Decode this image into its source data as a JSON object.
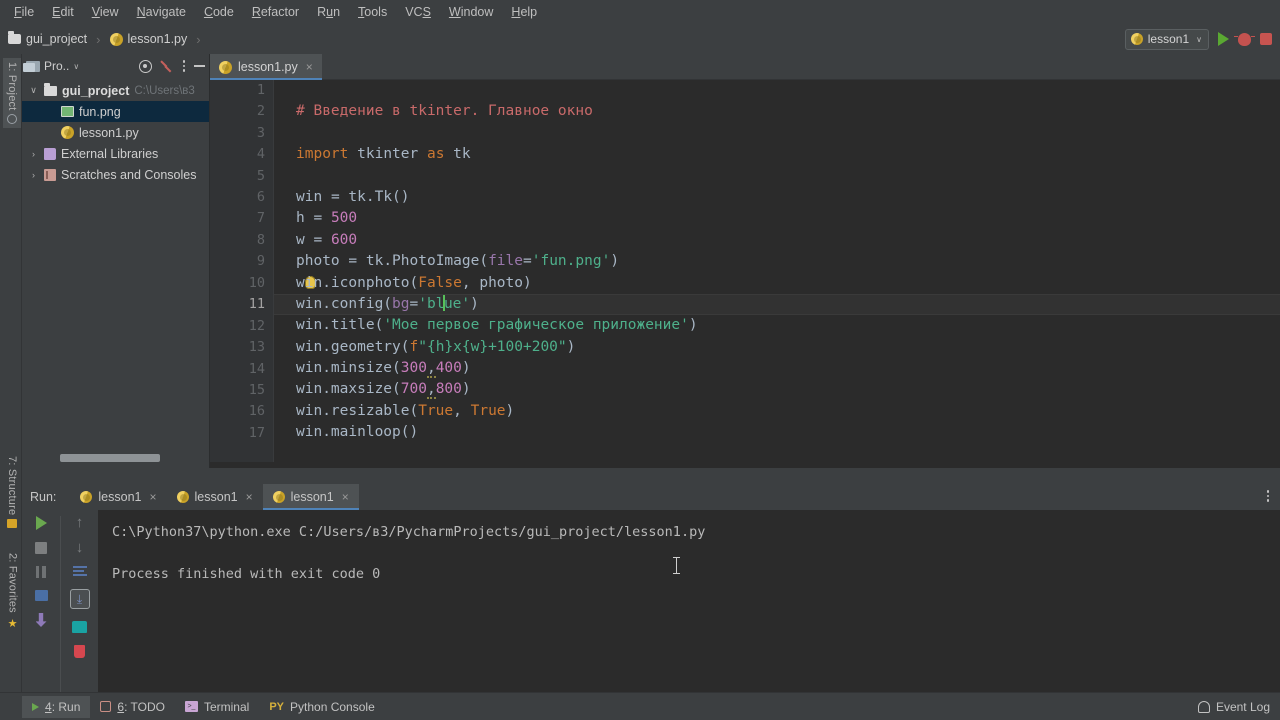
{
  "menubar": {
    "items": [
      {
        "label": "File",
        "mnemonic": "F"
      },
      {
        "label": "Edit",
        "mnemonic": "E"
      },
      {
        "label": "View",
        "mnemonic": "V"
      },
      {
        "label": "Navigate",
        "mnemonic": "N"
      },
      {
        "label": "Code",
        "mnemonic": "C"
      },
      {
        "label": "Refactor",
        "mnemonic": "R"
      },
      {
        "label": "Run",
        "mnemonic": "u"
      },
      {
        "label": "Tools",
        "mnemonic": "T"
      },
      {
        "label": "VCS",
        "mnemonic": "S"
      },
      {
        "label": "Window",
        "mnemonic": "W"
      },
      {
        "label": "Help",
        "mnemonic": "H"
      }
    ]
  },
  "breadcrumb": {
    "project": "gui_project",
    "file": "lesson1.py",
    "separator": "›"
  },
  "toolbar": {
    "run_config": "lesson1",
    "chevron": "∨",
    "run_icon": "run-triangle-icon",
    "debug_icon": "debug-bug-icon",
    "stop_icon": "stop-square-icon"
  },
  "left_strips": {
    "project_tab": "1: Project",
    "project_mnemonic": "1",
    "structure_tab": "7: Structure",
    "structure_mnemonic": "7",
    "favorites_tab": "2: Favorites",
    "favorites_mnemonic": "2"
  },
  "project_panel": {
    "title": "Pro..",
    "chevron": "∨",
    "icons": [
      "show-options-icon",
      "locate-target-icon",
      "collapse-all-icon",
      "kebab-menu-icon",
      "hide-icon"
    ],
    "tree": [
      {
        "indent": 0,
        "twisty": "∨",
        "icon": "folder-icon",
        "label": "gui_project",
        "bold": true,
        "path": "C:\\Users\\в3",
        "selected": false
      },
      {
        "indent": 1,
        "twisty": "",
        "icon": "png-image-icon",
        "label": "fun.png",
        "bold": false,
        "path": "",
        "selected": true
      },
      {
        "indent": 1,
        "twisty": "",
        "icon": "python-file-icon",
        "label": "lesson1.py",
        "bold": false,
        "path": "",
        "selected": false
      },
      {
        "indent": 0,
        "twisty": "›",
        "icon": "library-icon",
        "label": "External Libraries",
        "bold": false,
        "path": "",
        "selected": false
      },
      {
        "indent": 0,
        "twisty": "›",
        "icon": "scratches-icon",
        "label": "Scratches and Consoles",
        "bold": false,
        "path": "",
        "selected": false
      }
    ]
  },
  "editor": {
    "tab_label": "lesson1.py",
    "tab_close": "×",
    "current_line": 11,
    "first_line": 1,
    "last_line": 17,
    "lines": [
      {
        "n": 1,
        "text": ""
      },
      {
        "n": 2,
        "text": "# Введение в tkinter. Главное окно"
      },
      {
        "n": 3,
        "text": ""
      },
      {
        "n": 4,
        "text": "import tkinter as tk"
      },
      {
        "n": 5,
        "text": ""
      },
      {
        "n": 6,
        "text": "win = tk.Tk()"
      },
      {
        "n": 7,
        "text": "h = 500"
      },
      {
        "n": 8,
        "text": "w = 600"
      },
      {
        "n": 9,
        "text": "photo = tk.PhotoImage(file='fun.png')"
      },
      {
        "n": 10,
        "text": "win.iconphoto(False, photo)"
      },
      {
        "n": 11,
        "text": "win.config(bg='blue')"
      },
      {
        "n": 12,
        "text": "win.title('Мое первое графическое приложение')"
      },
      {
        "n": 13,
        "text": "win.geometry(f\"{h}x{w}+100+200\")"
      },
      {
        "n": 14,
        "text": "win.minsize(300,400)"
      },
      {
        "n": 15,
        "text": "win.maxsize(700,800)"
      },
      {
        "n": 16,
        "text": "win.resizable(True, True)"
      },
      {
        "n": 17,
        "text": "win.mainloop()"
      }
    ],
    "tokens": {
      "comment": "# Введение в tkinter. Главное окно",
      "kw_import": "import",
      "kw_as": "as",
      "mod_tkinter": "tkinter",
      "alias_tk": "tk",
      "win": "win",
      "eq": "=",
      "tk_Tk": "tk.Tk()",
      "h": "h",
      "h_val": "500",
      "w": "w",
      "w_val": "600",
      "photo": "photo",
      "photoimage_call": "tk.PhotoImage(",
      "kwarg_file": "file",
      "str_fun_png": "'fun.png'",
      "iconphoto_call": "win.iconphoto(",
      "kw_false": "False",
      "arg_photo": " photo)",
      "config_call": "win.config(",
      "kwarg_bg": "bg",
      "str_blue_a": "'bl",
      "str_blue_b": "ue'",
      "paren_close": ")",
      "title_call": "win.title(",
      "str_title": "'Мое первое графическое приложение'",
      "geometry_call": "win.geometry(",
      "fstring_f": "f",
      "fstring_body": "\"{h}x{w}+100+200\"",
      "minsize_call": "win.minsize(",
      "min_w": "300",
      "min_h": "400",
      "maxsize_call": "win.maxsize(",
      "max_w": "700",
      "max_h": "800",
      "resizable_call": "win.resizable(",
      "kw_true": "True",
      "mainloop_call": "win.mainloop()",
      "comma": ","
    },
    "colors": {
      "background": "#2b2b2b",
      "gutter": "#313335",
      "default_text": "#a9b7c6",
      "keyword": "#cc7832",
      "comment": "#c96a6a",
      "number": "#c77dbb",
      "string": "#4eb08b",
      "kwarg": "#9876aa",
      "current_line": "#323232",
      "caret": "#57c05a"
    },
    "intention_bulb": "intention-bulb-icon"
  },
  "run_panel": {
    "label": "Run:",
    "tabs": [
      {
        "label": "lesson1",
        "active": false,
        "close": "×"
      },
      {
        "label": "lesson1",
        "active": false,
        "close": "×"
      },
      {
        "label": "lesson1",
        "active": true,
        "close": "×"
      }
    ],
    "tools_left": [
      "rerun-play-icon",
      "stop-icon",
      "pause-icon",
      "grid-icon",
      "pin-icon"
    ],
    "tools_right": [
      "up-arrow-icon",
      "down-arrow-icon",
      "soft-wrap-icon",
      "scroll-to-end-icon",
      "print-icon",
      "clear-all-trash-icon"
    ],
    "console": {
      "command": "C:\\Python37\\python.exe C:/Users/в3/PycharmProjects/gui_project/lesson1.py",
      "blank": "",
      "result": "Process finished with exit code 0"
    }
  },
  "status_bar": {
    "items": [
      {
        "label": "4: Run",
        "mnemonic": "4",
        "icon": "run-triangle-icon",
        "active": true
      },
      {
        "label": "6: TODO",
        "mnemonic": "6",
        "icon": "todo-icon",
        "active": false
      },
      {
        "label": "Terminal",
        "mnemonic": "",
        "icon": "terminal-icon",
        "active": false
      },
      {
        "label": "Python Console",
        "mnemonic": "",
        "icon": "python-console-icon",
        "active": false
      }
    ],
    "event_log": "Event Log",
    "event_log_icon": "bell-icon"
  }
}
